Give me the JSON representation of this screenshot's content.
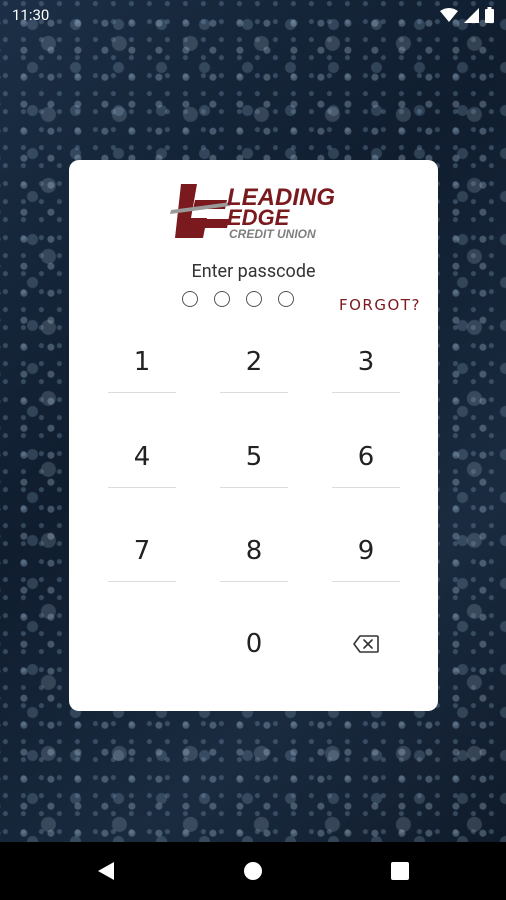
{
  "status_bar": {
    "time": "11:30"
  },
  "logo": {
    "line1": "LEADING",
    "line2": "EDGE",
    "line3": "CREDIT UNION",
    "color": "#7a1a1f"
  },
  "passcode": {
    "prompt": "Enter passcode",
    "length": 4,
    "filled": 0
  },
  "forgot_label": "FORGOT?",
  "keypad": {
    "k1": "1",
    "k2": "2",
    "k3": "3",
    "k4": "4",
    "k5": "5",
    "k6": "6",
    "k7": "7",
    "k8": "8",
    "k9": "9",
    "k0": "0"
  },
  "icons": [
    "wifi-icon",
    "cell-signal-icon",
    "battery-icon",
    "backspace-icon",
    "nav-back-icon",
    "nav-home-icon",
    "nav-recents-icon"
  ]
}
